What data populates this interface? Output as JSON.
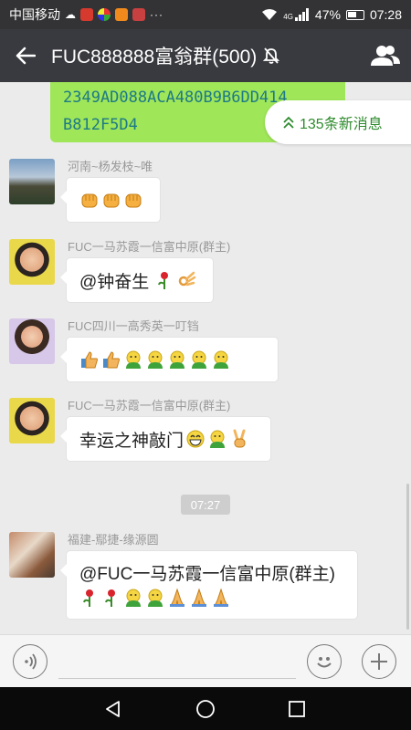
{
  "status_bar": {
    "carrier": "中国移动",
    "network": "4G",
    "battery": "47%",
    "time": "07:28",
    "more": "···"
  },
  "header": {
    "title": "FUC888888富翁群(500)",
    "back_icon": "arrow-left-icon",
    "mute_icon": "bell-off-icon",
    "members_icon": "group-icon"
  },
  "chat": {
    "outgoing_partial": {
      "line1": "2349AD088ACA480B9B6DD414",
      "line2": "B812F5D4"
    },
    "new_messages_label": "135条新消息",
    "time_divider": "07:27",
    "messages": [
      {
        "sender": "河南~杨发枝~唯",
        "text": "",
        "emojis": [
          "fist",
          "fist",
          "fist"
        ]
      },
      {
        "sender": "FUC一马苏霞一信富中原(群主)",
        "text": "@钟奋生",
        "emojis": [
          "rose",
          "ok-hand"
        ]
      },
      {
        "sender": "FUC四川一高秀英一叮铛",
        "text": "",
        "emojis": [
          "thumbs-up",
          "thumbs-up",
          "green-face",
          "green-face",
          "green-face",
          "green-face",
          "green-face"
        ]
      },
      {
        "sender": "FUC一马苏霞一信富中原(群主)",
        "text": "幸运之神敲门",
        "emojis": [
          "grin",
          "green-face",
          "victory"
        ]
      },
      {
        "sender": "福建-鄢捷-缘源圆",
        "text": "@FUC一马苏霞一信富中原(群主)",
        "emojis": [
          "rose",
          "rose",
          "green-face",
          "green-face",
          "pray",
          "pray",
          "pray"
        ]
      }
    ]
  },
  "input_bar": {
    "placeholder": "",
    "voice_icon": "voice-icon",
    "emoji_icon": "smiley-icon",
    "plus_icon": "plus-icon"
  },
  "nav_bar": {
    "back_icon": "triangle-back-icon",
    "home_icon": "circle-home-icon",
    "recent_icon": "square-recent-icon"
  }
}
